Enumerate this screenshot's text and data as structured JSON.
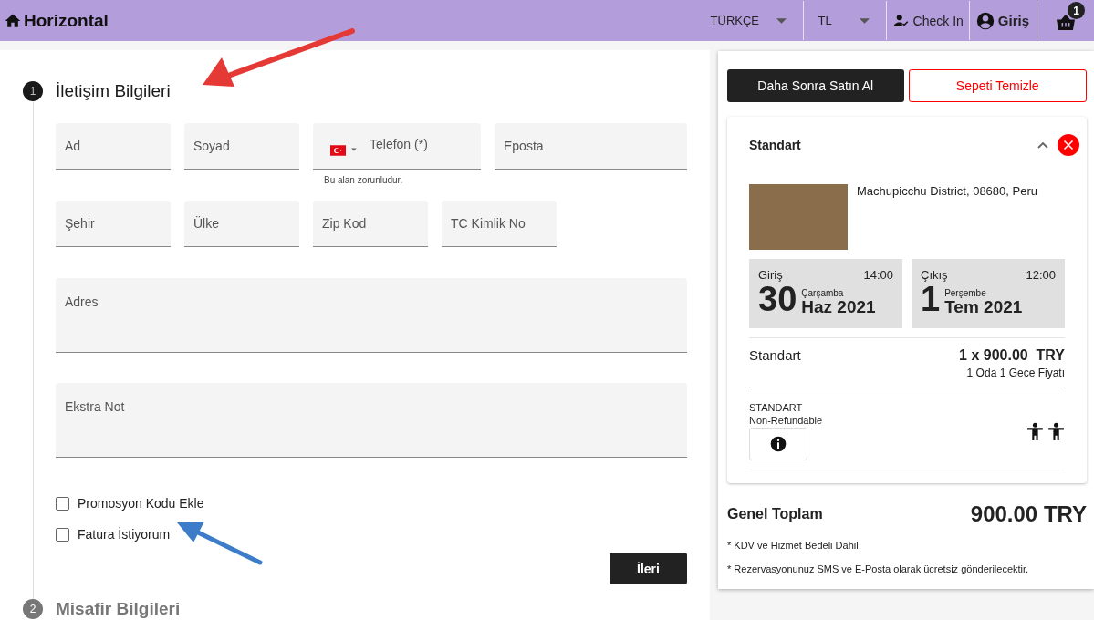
{
  "header": {
    "brand": "Horizontal",
    "language": "TÜRKÇE",
    "currency": "TL",
    "check_in": "Check In",
    "login": "Giriş",
    "cart_count": "1"
  },
  "steps": [
    {
      "number": "1",
      "title": "İletişim Bilgileri",
      "active": true
    },
    {
      "number": "2",
      "title": "Misafir Bilgileri",
      "active": false
    }
  ],
  "form": {
    "rows": [
      [
        {
          "kind": "text",
          "placeholder": "Ad"
        },
        {
          "kind": "text",
          "placeholder": "Soyad"
        },
        {
          "kind": "phone",
          "placeholder": "Telefon (*)",
          "hint": "Bu alan zorunludur."
        },
        {
          "kind": "text",
          "placeholder": "Eposta"
        }
      ],
      [
        {
          "kind": "text",
          "placeholder": "Şehir"
        },
        {
          "kind": "text",
          "placeholder": "Ülke"
        },
        {
          "kind": "text",
          "placeholder": "Zip Kod"
        },
        {
          "kind": "text",
          "placeholder": "TC Kimlik No"
        }
      ],
      [
        {
          "kind": "textarea",
          "placeholder": "Adres"
        }
      ],
      [
        {
          "kind": "textarea",
          "placeholder": "Ekstra Not"
        }
      ]
    ],
    "checkboxes": [
      {
        "label": "Promosyon Kodu Ekle",
        "checked": false
      },
      {
        "label": "Fatura İstiyorum",
        "checked": false
      }
    ],
    "next_button": "İleri"
  },
  "summary": {
    "buy_later_button": "Daha Sonra Satın Al",
    "clear_cart_button": "Sepeti Temizle",
    "item": {
      "title": "Standart",
      "expanded": true,
      "address": "Machupicchu District, 08680, Peru",
      "dates": [
        {
          "label": "Giriş",
          "time": "14:00",
          "day": "30",
          "weekday": "Çarşamba",
          "month_year": "Haz 2021"
        },
        {
          "label": "Çıkış",
          "time": "12:00",
          "day": "1",
          "weekday": "Perşembe",
          "month_year": "Tem 2021"
        }
      ],
      "room": "Standart",
      "price": "1 x 900.00  TRY",
      "price_note": "1 Oda 1 Gece Fiyatı",
      "rate": "STANDART",
      "policy": "Non-Refundable"
    },
    "total_label": "Genel Toplam",
    "total": "900.00 TRY",
    "notes": [
      "* KDV ve Hizmet Bedeli Dahil",
      "* Rezervasyonunuz SMS ve E-Posta olarak ücretsiz gönderilecektir."
    ]
  }
}
